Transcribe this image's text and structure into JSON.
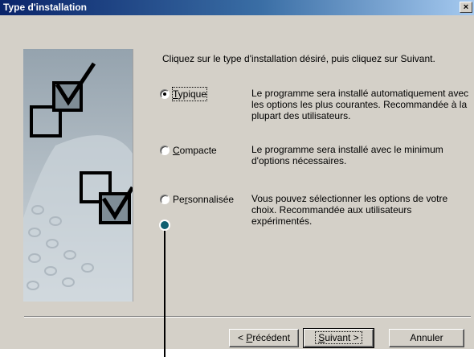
{
  "window": {
    "title": "Type d'installation",
    "close_glyph": "×"
  },
  "instructions": "Cliquez sur le type d'installation désiré, puis cliquez sur Suivant.",
  "options": [
    {
      "label_prefix": "",
      "mnemonic": "T",
      "label_suffix": "ypique",
      "selected": true,
      "description": "Le programme sera installé automatiquement avec les options les plus courantes. Recommandée à la plupart des utilisateurs."
    },
    {
      "label_prefix": "",
      "mnemonic": "C",
      "label_suffix": "ompacte",
      "selected": false,
      "description": "Le programme sera installé avec le minimum d'options nécessaires."
    },
    {
      "label_prefix": "Pe",
      "mnemonic": "r",
      "label_suffix": "sonnalisée",
      "selected": false,
      "description": "Vous pouvez sélectionner les options de votre choix. Recommandée aux utilisateurs expérimentés."
    }
  ],
  "buttons": {
    "previous": {
      "prefix": "< ",
      "mnemonic": "P",
      "suffix": "récédent"
    },
    "next": {
      "mnemonic": "S",
      "suffix": "uivant >"
    },
    "cancel": {
      "label": "Annuler"
    }
  },
  "colors": {
    "dialog_bg": "#d4d0c8",
    "title_start": "#0a246a",
    "title_end": "#a6caf0",
    "callout": "#0f5f70"
  }
}
